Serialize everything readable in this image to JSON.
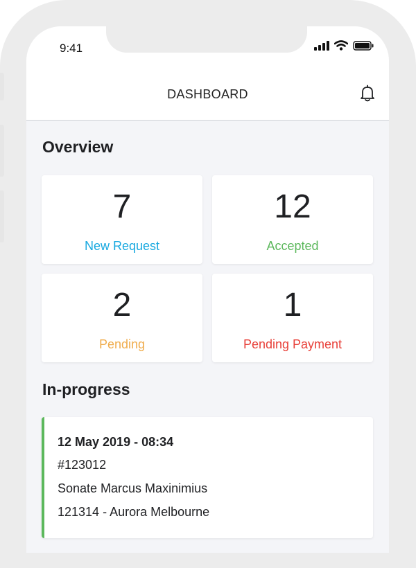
{
  "status_bar": {
    "time": "9:41"
  },
  "header": {
    "title": "DASHBOARD"
  },
  "overview": {
    "title": "Overview",
    "cards": [
      {
        "value": "7",
        "label": "New Request",
        "color": "#19a9e0"
      },
      {
        "value": "12",
        "label": "Accepted",
        "color": "#5cb85c"
      },
      {
        "value": "2",
        "label": "Pending",
        "color": "#f0ad4e"
      },
      {
        "value": "1",
        "label": "Pending Payment",
        "color": "#e8413a"
      }
    ]
  },
  "in_progress": {
    "title": "In-progress",
    "items": [
      {
        "datetime": "12 May 2019 - 08:34",
        "id": "#123012",
        "name": "Sonate Marcus Maxinimius",
        "location": "121314 - Aurora Melbourne",
        "accent_color": "#5cb85c"
      }
    ]
  },
  "icons": {
    "bell": "bell-icon",
    "signal": "signal-icon",
    "wifi": "wifi-icon",
    "battery": "battery-icon"
  }
}
